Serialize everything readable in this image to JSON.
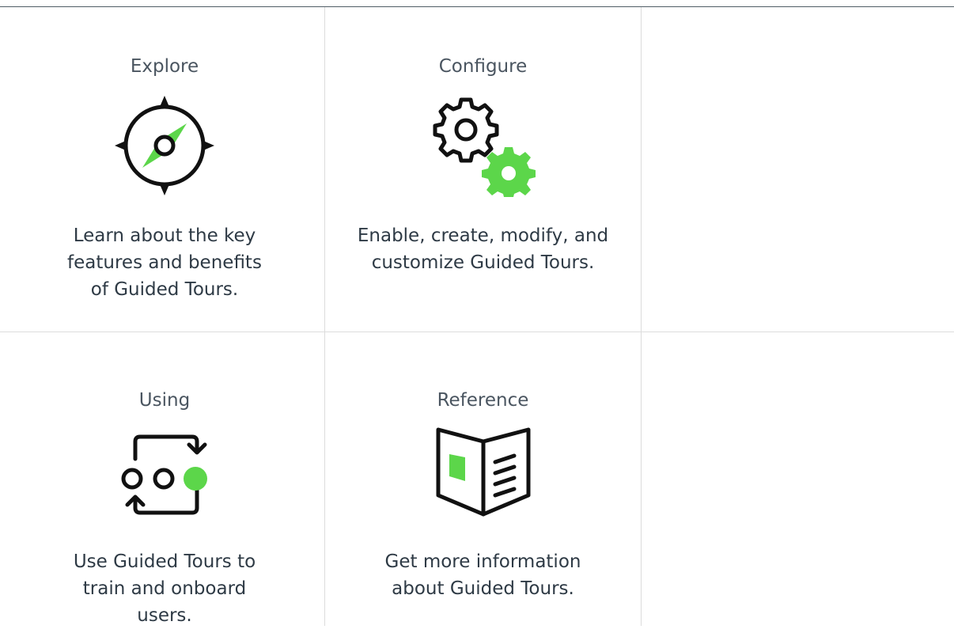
{
  "cards": [
    {
      "title": "Explore",
      "icon": "compass-icon",
      "description": "Learn about the key features and benefits of Guided Tours."
    },
    {
      "title": "Configure",
      "icon": "gears-icon",
      "description": "Enable, create, modify, and customize Guided Tours."
    },
    {
      "title": "Using",
      "icon": "cycle-steps-icon",
      "description": "Use Guided Tours to train and onboard users."
    },
    {
      "title": "Reference",
      "icon": "open-book-icon",
      "description": "Get more information about Guided Tours."
    }
  ],
  "colors": {
    "accent": "#5cd64a",
    "icon_stroke": "#111111",
    "title_text": "#4a5560",
    "desc_text": "#2e3a45",
    "divider": "#dcdcdc",
    "top_rule": "#4f5d66"
  }
}
